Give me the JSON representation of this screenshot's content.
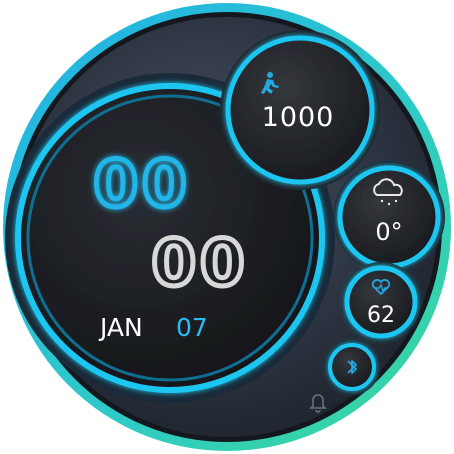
{
  "watchface": {
    "time": {
      "hours": "00",
      "minutes": "00"
    },
    "date": {
      "month": "JAN",
      "day": "07"
    },
    "complications": {
      "steps": {
        "icon": "running-person-icon",
        "value": "1000"
      },
      "weather": {
        "icon": "cloud-snow-icon",
        "value": "0°"
      },
      "heart_rate": {
        "icon": "heart-pulse-icon",
        "value": "62"
      },
      "bluetooth": {
        "icon": "bluetooth-icon"
      },
      "alarm": {
        "icon": "bell-icon"
      }
    },
    "colors": {
      "accent_cyan": "#1ec6f0",
      "accent_green": "#38d39a",
      "hour_digits": "#22b6e8",
      "minute_digits": "#d8d8d8",
      "date_month": "#ffffff",
      "date_day": "#2bbcf0",
      "face_dark": "#1a1d22"
    }
  }
}
